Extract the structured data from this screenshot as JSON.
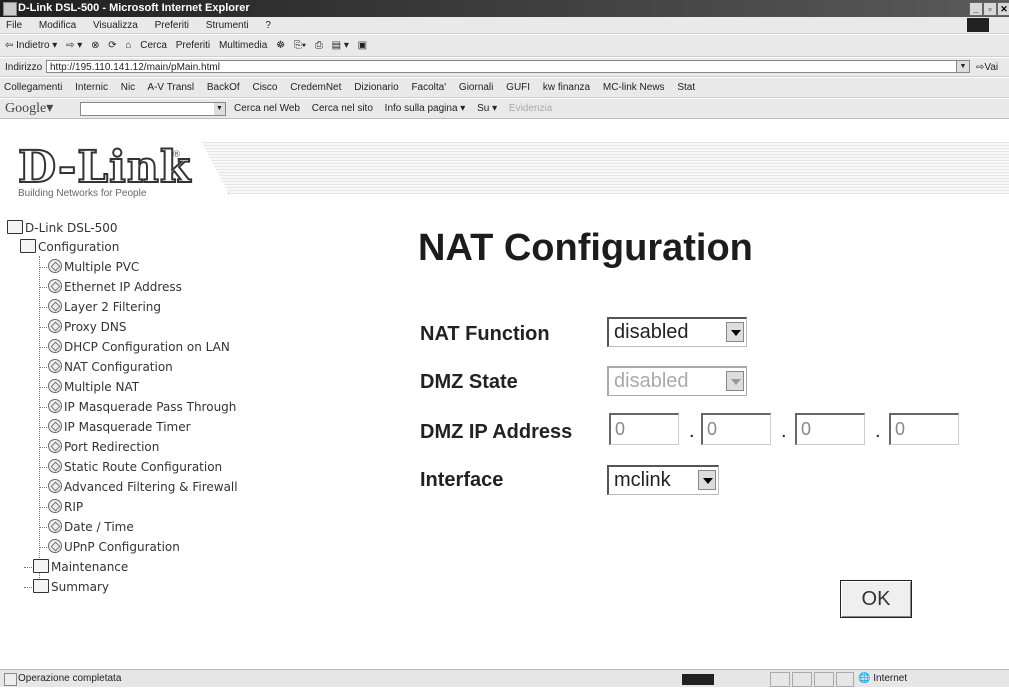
{
  "window": {
    "title": "D-Link DSL-500 - Microsoft Internet Explorer"
  },
  "menu": [
    "File",
    "Modifica",
    "Visualizza",
    "Preferiti",
    "Strumenti",
    "?"
  ],
  "toolbar": [
    "⇦ Indietro ▾",
    "⇨ ▾",
    "⊗",
    "⟳",
    "⌂",
    "Cerca",
    "Preferiti",
    "Multimedia",
    "☸",
    "⎘▾",
    "⎙",
    "▤ ▾",
    "▣"
  ],
  "address": {
    "label": "Indirizzo",
    "url": "http://195.110.141.12/main/pMain.html",
    "go": "Vai"
  },
  "links": [
    "Collegamenti",
    "Internic",
    "Nic",
    "A-V Transl",
    "BackOf",
    "Cisco",
    "CredemNet",
    "Dizionario",
    "Facolta'",
    "Giornali",
    "GUFI",
    "kw finanza",
    "MC-link News",
    "Stat"
  ],
  "google": {
    "label": "Google▾",
    "items": [
      "Cerca nel Web",
      "Cerca nel sito",
      "Info sulla pagina ▾",
      "Su ▾"
    ],
    "disabled_item": "Evidenzia"
  },
  "brand": {
    "logo": "D-Link",
    "tagline": "Building Networks for People"
  },
  "tree": {
    "root": "D-Link DSL-500",
    "configuration": "Configuration",
    "items": [
      "Multiple PVC",
      "Ethernet IP Address",
      "Layer 2 Filtering",
      "Proxy DNS",
      "DHCP Configuration on LAN",
      "NAT Configuration",
      "Multiple NAT",
      "IP Masquerade Pass Through",
      "IP Masquerade Timer",
      "Port Redirection",
      "Static Route Configuration",
      "Advanced Filtering & Firewall",
      "RIP",
      "Date / Time",
      "UPnP Configuration"
    ],
    "maintenance": "Maintenance",
    "summary": "Summary"
  },
  "form": {
    "title": "NAT Configuration",
    "nat_function_label": "NAT Function",
    "nat_function_value": "disabled",
    "dmz_state_label": "DMZ State",
    "dmz_state_value": "disabled",
    "dmz_ip_label": "DMZ IP Address",
    "dmz_ip": [
      "0",
      "0",
      "0",
      "0"
    ],
    "interface_label": "Interface",
    "interface_value": "mclink",
    "ok_label": "OK"
  },
  "status": {
    "text": "Operazione completata",
    "zone": "Internet"
  }
}
